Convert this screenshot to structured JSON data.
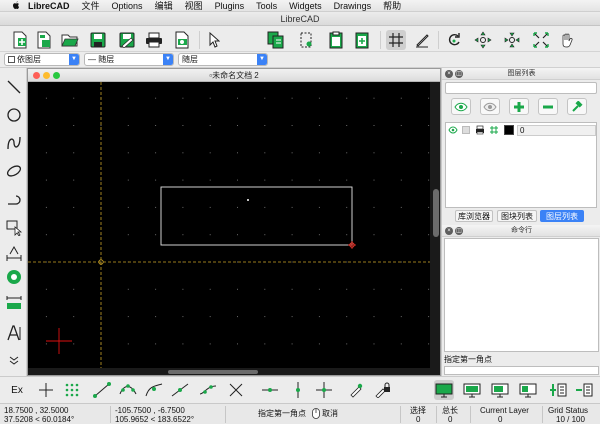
{
  "menubar": {
    "app": "LibreCAD",
    "items": [
      "文件",
      "Options",
      "编辑",
      "视图",
      "Plugins",
      "Tools",
      "Widgets",
      "Drawings",
      "帮助"
    ]
  },
  "window": {
    "title": "LibreCAD"
  },
  "layer_toolbar": {
    "layer_select": "依图层",
    "line_type_select": "— 随层",
    "line_width_select": "随层"
  },
  "document": {
    "title": "未命名文档 2"
  },
  "layer_panel": {
    "title": "图层列表",
    "search_placeholder": "",
    "layer_row": {
      "name": "0"
    },
    "tabs": [
      "库浏览器",
      "图块列表",
      "图层列表"
    ],
    "active_tab": "图层列表"
  },
  "command_panel": {
    "title": "命令行",
    "prompt": "指定第一角点"
  },
  "snapbar": {
    "exclusive_label": "Ex"
  },
  "status": {
    "abs_coord": "18.7500 , 32.5000",
    "abs_polar": "37.5208 < 60.0184°",
    "rel_coord": "-105.7500 , -6.7500",
    "rel_polar": "105.9652 < 183.6522°",
    "hint_first": "指定第一角点",
    "hint_cancel": "取消",
    "selected_label": "选择",
    "selected_value": "0",
    "total_label": "总长",
    "total_value": "0",
    "current_layer_label": "Current Layer",
    "current_layer_value": "0",
    "grid_status_label": "Grid Status",
    "grid_status_value": "10 / 100"
  },
  "colors": {
    "canvas": "#000000",
    "grid": "#6b6b6b",
    "selection_box": "#e6e6e6",
    "crosshair": "#c9a227",
    "endpoint": "#ff3b30",
    "icon_green": "#1aa84a",
    "accent": "#3b82f6"
  }
}
